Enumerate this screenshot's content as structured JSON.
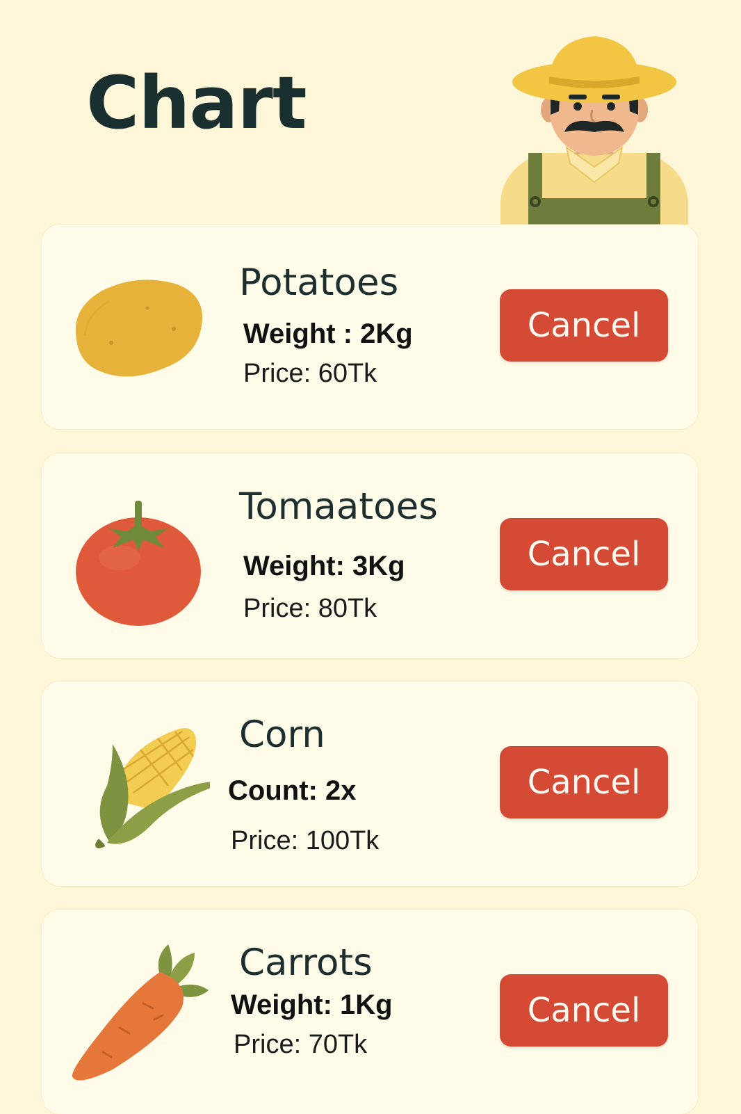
{
  "header": {
    "title": "Chart",
    "avatar_icon": "farmer-avatar-icon"
  },
  "items": [
    {
      "name": "Potatoes",
      "quantity": "Weight : 2Kg",
      "price": "Price: 60Tk",
      "icon": "potato-icon",
      "action_label": "Cancel"
    },
    {
      "name": "Tomaatoes",
      "quantity": "Weight: 3Kg",
      "price": "Price: 80Tk",
      "icon": "tomato-icon",
      "action_label": "Cancel"
    },
    {
      "name": "Corn",
      "quantity": "Count: 2x",
      "price": "Price: 100Tk",
      "icon": "corn-icon",
      "action_label": "Cancel"
    },
    {
      "name": "Carrots",
      "quantity": "Weight: 1Kg",
      "price": "Price: 70Tk",
      "icon": "carrot-icon",
      "action_label": "Cancel"
    }
  ],
  "colors": {
    "background": "#fdf6d8",
    "card": "#fefbe8",
    "cancel_button": "#d44a35",
    "title_text": "#1a3030"
  }
}
